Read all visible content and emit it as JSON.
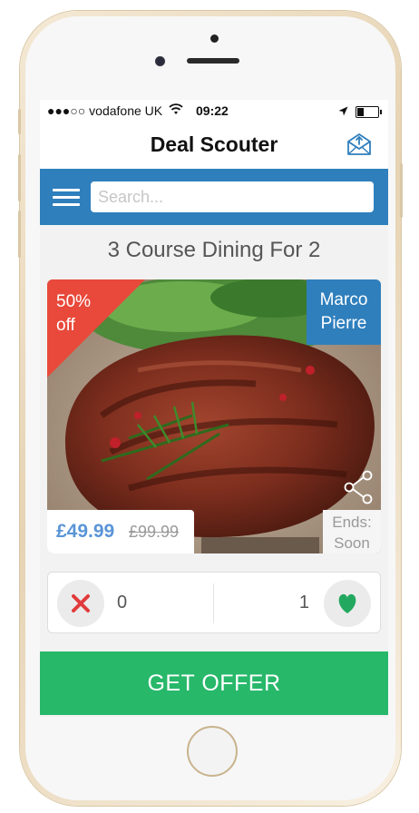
{
  "status_bar": {
    "carrier": "●●●○○ vodafone UK",
    "time": "09:22"
  },
  "header": {
    "title": "Deal Scouter",
    "icon": "mail-icon"
  },
  "search": {
    "placeholder": "Search...",
    "value": ""
  },
  "deal": {
    "title": "3 Course Dining For 2",
    "discount_line1": "50%",
    "discount_line2": "off",
    "chef_line1": "Marco",
    "chef_line2": "Pierre",
    "price": "£49.99",
    "original_price": "£99.99",
    "ends_label": "Ends:",
    "ends_value": "Soon"
  },
  "votes": {
    "dislike_count": "0",
    "like_count": "1"
  },
  "cta": {
    "label": "GET OFFER"
  },
  "colors": {
    "primary": "#2f7fbd",
    "accent_red": "#e8493a",
    "offer_green": "#27b86a",
    "price_blue": "#5a95d6"
  }
}
